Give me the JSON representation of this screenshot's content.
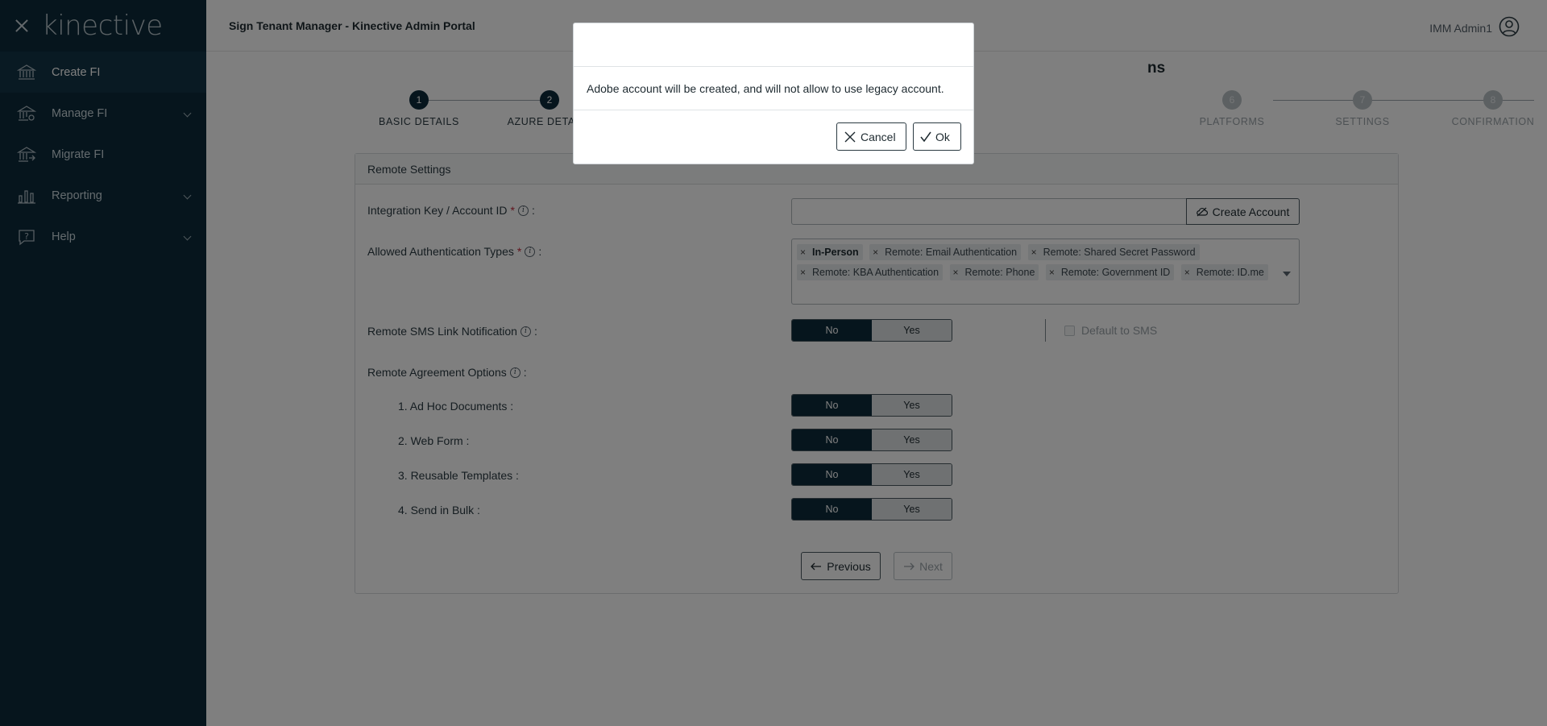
{
  "brand": {
    "logo_text": "kinective"
  },
  "sidebar": {
    "items": [
      {
        "label": "Create FI",
        "icon": "bank-icon",
        "active": true
      },
      {
        "label": "Manage FI",
        "icon": "bank-settings-icon",
        "has_submenu": true
      },
      {
        "label": "Migrate FI",
        "icon": "bank-migrate-icon"
      },
      {
        "label": "Reporting",
        "icon": "bar-chart-icon",
        "has_submenu": true
      },
      {
        "label": "Help",
        "icon": "help-chat-icon",
        "has_submenu": true
      }
    ]
  },
  "header": {
    "title": "Sign Tenant Manager - Kinective Admin Portal",
    "user_name": "IMM Admin1"
  },
  "page": {
    "heading_fragment": "ns"
  },
  "stepper": {
    "steps": [
      {
        "num": "1",
        "label": "BASIC DETAILS",
        "state": "done"
      },
      {
        "num": "2",
        "label": "AZURE DETAILS",
        "state": "current"
      },
      {
        "num": "6",
        "label": "PLATFORMS",
        "state": "todo"
      },
      {
        "num": "7",
        "label": "SETTINGS",
        "state": "todo"
      },
      {
        "num": "8",
        "label": "CONFIRMATION",
        "state": "todo"
      }
    ]
  },
  "card": {
    "title": "Remote Settings",
    "integration_key_label": "Integration Key / Account ID",
    "integration_key_value": "",
    "create_account_label": "Create Account",
    "auth_types_label": "Allowed Authentication Types",
    "auth_types": [
      "In-Person",
      "Remote: Email Authentication",
      "Remote: Shared Secret Password",
      "Remote: KBA Authentication",
      "Remote: Phone",
      "Remote: Government ID",
      "Remote: ID.me"
    ],
    "sms_label": "Remote SMS Link Notification",
    "sms_value": "No",
    "default_sms_label": "Default to SMS",
    "agreement_label": "Remote Agreement Options",
    "options": [
      {
        "label": "1. Ad Hoc Documents :",
        "value": "No"
      },
      {
        "label": "2. Web Form :",
        "value": "No"
      },
      {
        "label": "3. Reusable Templates :",
        "value": "No"
      },
      {
        "label": "4. Send in Bulk :",
        "value": "No"
      }
    ],
    "toggle_no": "No",
    "toggle_yes": "Yes",
    "colon": ":",
    "required_mark": "*",
    "info_glyph": "i"
  },
  "footer": {
    "previous_label": "Previous",
    "next_label": "Next"
  },
  "modal": {
    "message": "Adobe account will be created, and will not allow to use legacy account.",
    "cancel_label": "Cancel",
    "ok_label": "Ok"
  },
  "colors": {
    "sidebar_bg": "#0c2a3a",
    "accent": "#0c2a3a",
    "required": "#c2273a"
  }
}
